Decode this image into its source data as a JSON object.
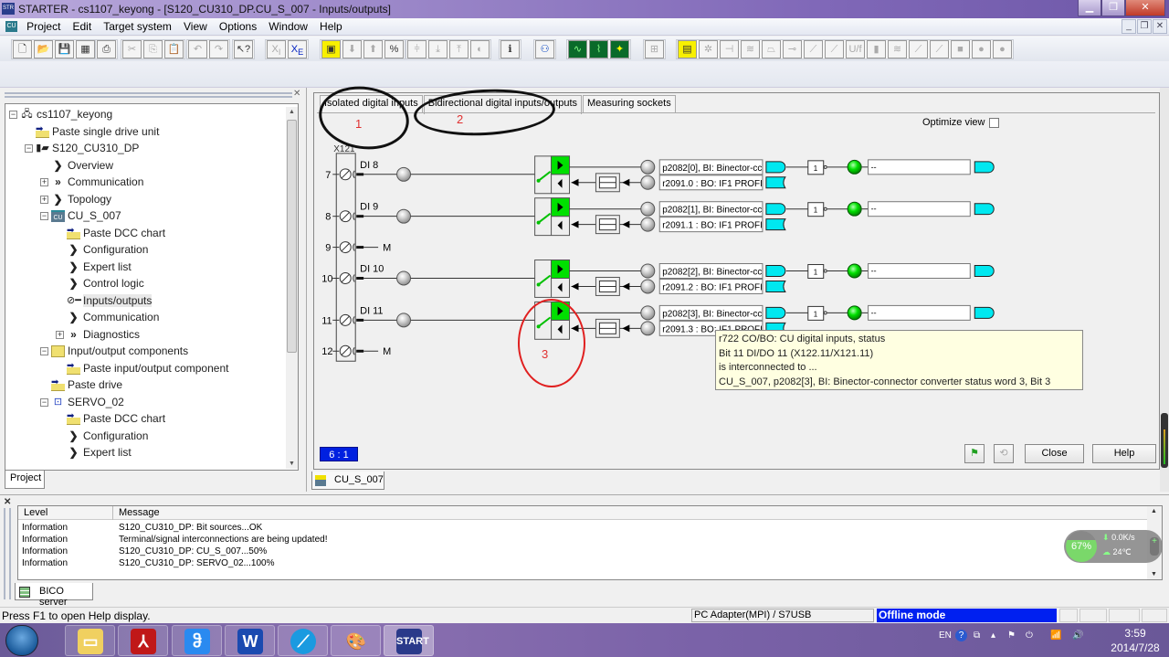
{
  "window": {
    "title": "STARTER - cs1107_keyong - [S120_CU310_DP.CU_S_007 - Inputs/outputs]",
    "app_icon": "STARTER",
    "controls": [
      "minimize",
      "restore",
      "close"
    ]
  },
  "menu": {
    "items": [
      "Project",
      "Edit",
      "Target system",
      "View",
      "Options",
      "Window",
      "Help"
    ],
    "doc_icon": "CU"
  },
  "toolbar": {
    "groups": [
      [
        "new-icon",
        "open-icon",
        "save-icon",
        "compile-icon"
      ],
      [
        "print-icon"
      ],
      [
        "cut-icon",
        "copy-icon",
        "paste-icon"
      ],
      [
        "undo-icon",
        "redo-icon"
      ],
      [
        "context-help-icon"
      ],
      [
        "xi-icon",
        "xe-icon"
      ],
      [
        "connect-target-icon",
        "download-icon",
        "upload-icon",
        "online-offline-icon"
      ],
      [
        "split-icon",
        "load-to-pg-icon",
        "copy-ram-rom-icon",
        "restore-factory-icon"
      ],
      [
        "device-info-icon"
      ],
      [
        "accessible-nodes-icon"
      ],
      [
        "trace-icon",
        "function-gen-icon",
        "measure-icon"
      ],
      [
        "bico-icon"
      ],
      [
        "expert-list-icon",
        "config-icon",
        "limit-icon",
        "setpoint-icon",
        "ramp-icon",
        "speed-ctrl-icon",
        "current-ctrl-icon",
        "torque-icon",
        "vf-icon",
        "pos-icon",
        "brake-icon",
        "curve-i-icon",
        "curve-i2-icon",
        "stop-square-icon",
        "stop-circle-icon",
        "stop-circle2-icon"
      ]
    ]
  },
  "tree": {
    "items": [
      {
        "label": "cs1107_keyong",
        "icon": "project-icon",
        "expander": "-"
      },
      {
        "label": "Paste single drive unit",
        "icon": "paste-icon"
      },
      {
        "label": "S120_CU310_DP",
        "icon": "drive-unit-icon",
        "expander": "-"
      },
      {
        "label": "Overview",
        "icon": "chevron-icon"
      },
      {
        "label": "Communication",
        "icon": "double-chevron-icon",
        "expander": "+"
      },
      {
        "label": "Topology",
        "icon": "chevron-icon",
        "expander": "+"
      },
      {
        "label": "CU_S_007",
        "icon": "cu-icon",
        "expander": "-"
      },
      {
        "label": "Paste DCC chart",
        "icon": "paste-icon"
      },
      {
        "label": "Configuration",
        "icon": "chevron-icon"
      },
      {
        "label": "Expert list",
        "icon": "chevron-icon"
      },
      {
        "label": "Control logic",
        "icon": "chevron-icon"
      },
      {
        "label": "Inputs/outputs",
        "icon": "io-icon",
        "selected": true
      },
      {
        "label": "Communication",
        "icon": "chevron-icon"
      },
      {
        "label": "Diagnostics",
        "icon": "double-chevron-icon",
        "expander": "+"
      },
      {
        "label": "Input/output components",
        "icon": "folder-icon",
        "expander": "-"
      },
      {
        "label": "Paste input/output component",
        "icon": "paste-icon"
      },
      {
        "label": "Paste drive",
        "icon": "paste-icon"
      },
      {
        "label": "SERVO_02",
        "icon": "servo-icon",
        "expander": "-"
      },
      {
        "label": "Paste DCC chart",
        "icon": "paste-icon"
      },
      {
        "label": "Configuration",
        "icon": "chevron-icon"
      },
      {
        "label": "Expert list",
        "icon": "chevron-icon"
      }
    ],
    "bottom_tab": "Project"
  },
  "main": {
    "tabs": [
      {
        "label": "Isolated digital inputs"
      },
      {
        "label": "Bidirectional digital inputs/outputs",
        "active": true
      },
      {
        "label": "Measuring sockets"
      }
    ],
    "optimize_view_label": "Optimize view",
    "optimize_view_checked": false,
    "connector_label": "X121",
    "terminals": [
      {
        "pin": "7",
        "label": "DI 8",
        "type": "io",
        "bi": "p2082[0], BI: Binector-cc",
        "bo": "r2091.0 : BO: IF1 PROFI",
        "out": "--"
      },
      {
        "pin": "8",
        "label": "DI 9",
        "type": "io",
        "bi": "p2082[1], BI: Binector-cc",
        "bo": "r2091.1 : BO: IF1 PROFI",
        "out": "--"
      },
      {
        "pin": "9",
        "label": "M",
        "type": "ground"
      },
      {
        "pin": "10",
        "label": "DI 10",
        "type": "io",
        "bi": "p2082[2], BI: Binector-cc",
        "bo": "r2091.2 : BO: IF1 PROFI",
        "out": "--"
      },
      {
        "pin": "11",
        "label": "DI 11",
        "type": "io",
        "bi": "p2082[3], BI: Binector-cc",
        "bo": "r2091.3 : BO: IF1 PROFI",
        "out": "--"
      },
      {
        "pin": "12",
        "label": "M",
        "type": "ground"
      }
    ],
    "inverter_label": "1",
    "tooltip": {
      "lines": [
        "r722 CO/BO: CU digital inputs, status",
        "Bit 11 DI/DO 11 (X122.11/X121.11)",
        "is interconnected to ...",
        "CU_S_007, p2082[3], BI: Binector-connector converter status word 3, Bit 3"
      ]
    },
    "annotations": [
      "1",
      "2",
      "3"
    ],
    "zoom_indicator": "6 : 1",
    "close_label": "Close",
    "help_label": "Help",
    "bottom_tab": "CU_S_007"
  },
  "log": {
    "columns": [
      "Level",
      "Message"
    ],
    "rows": [
      {
        "level": "Information",
        "message": "S120_CU310_DP: Bit sources...OK"
      },
      {
        "level": "Information",
        "message": "Terminal/signal interconnections are being updated!"
      },
      {
        "level": "Information",
        "message": "S120_CU310_DP: CU_S_007...50%"
      },
      {
        "level": "Information",
        "message": "S120_CU310_DP: SERVO_02...100%"
      }
    ],
    "tab": "BICO server"
  },
  "widget": {
    "percent": "67%",
    "speed": "0.0K/s",
    "temp": "24℃"
  },
  "statusbar": {
    "help": "Press F1 to open Help display.",
    "adapter": "PC Adapter(MPI) / S7USB",
    "mode": "Offline mode"
  },
  "taskbar": {
    "apps": [
      "explorer-icon",
      "pdf-icon",
      "baidu-icon",
      "wps-icon",
      "browser-icon",
      "paint-icon",
      "starter-icon"
    ],
    "starter_label": "START",
    "lang": "EN",
    "time": "3:59",
    "date": "2014/7/28"
  },
  "colors": {
    "accent_blue": "#0020f0",
    "signal_green": "#00e000",
    "connector_cyan": "#00e8f0",
    "tooltip_bg": "#ffffe1"
  }
}
